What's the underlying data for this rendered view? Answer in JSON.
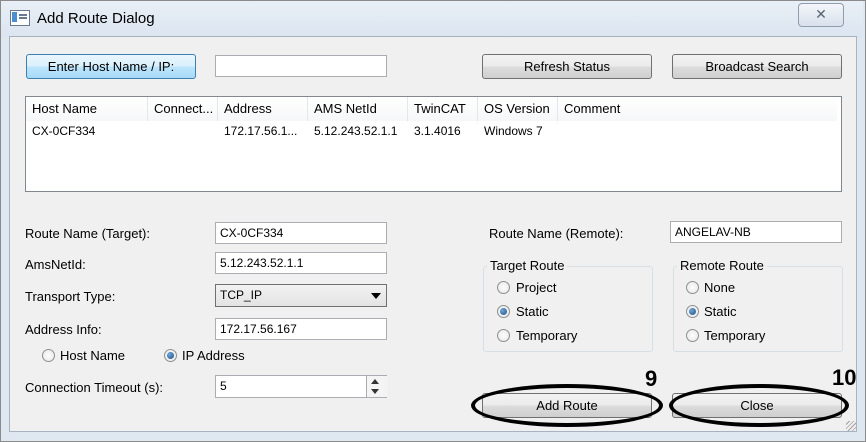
{
  "window": {
    "title": "Add Route Dialog",
    "close_glyph": "✕"
  },
  "top": {
    "enter_host_label": "Enter Host Name / IP:",
    "host_input_value": "",
    "refresh_label": "Refresh Status",
    "broadcast_label": "Broadcast Search"
  },
  "list": {
    "columns": [
      "Host Name",
      "Connect...",
      "Address",
      "AMS NetId",
      "TwinCAT",
      "OS Version",
      "Comment"
    ],
    "rows": [
      [
        "CX-0CF334",
        "",
        "172.17.56.1...",
        "5.12.243.52.1.1",
        "3.1.4016",
        "Windows 7",
        ""
      ]
    ]
  },
  "form": {
    "route_name_label": "Route Name (Target):",
    "route_name_value": "CX-0CF334",
    "amsnetid_label": "AmsNetId:",
    "amsnetid_value": "5.12.243.52.1.1",
    "transport_label": "Transport Type:",
    "transport_value": "TCP_IP",
    "address_info_label": "Address Info:",
    "address_info_value": "172.17.56.167",
    "host_name_radio": "Host Name",
    "ip_address_radio": "IP Address",
    "timeout_label": "Connection Timeout (s):",
    "timeout_value": "5",
    "route_remote_label": "Route Name (Remote):",
    "route_remote_value": "ANGELAV-NB"
  },
  "target_route": {
    "title": "Target Route",
    "project": "Project",
    "static": "Static",
    "temporary": "Temporary"
  },
  "remote_route": {
    "title": "Remote Route",
    "none": "None",
    "static": "Static",
    "temporary": "Temporary"
  },
  "buttons": {
    "add_route": "Add Route",
    "close": "Close"
  },
  "annotations": {
    "add_route_number": "9",
    "close_number": "10"
  },
  "colors": {
    "accent": "#3c7fb1",
    "annotation": "#000000"
  }
}
